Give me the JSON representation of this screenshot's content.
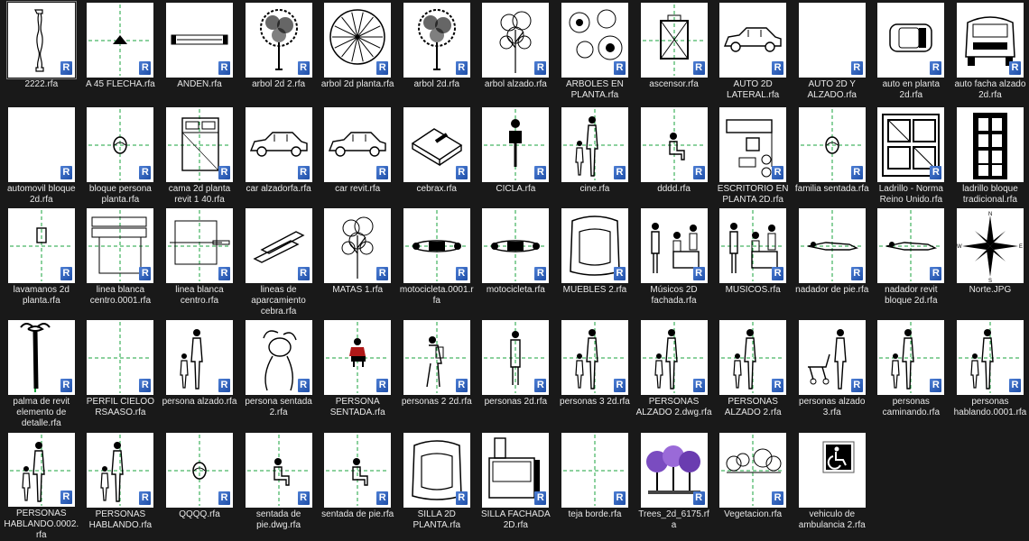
{
  "explorer": {
    "colors": {
      "background": "#191919",
      "thumb": "#ffffff",
      "text": "#e8e8e8",
      "badge": "#2c62c0",
      "crosshair": "#1aa33c"
    },
    "badge_letter": "R",
    "items": [
      {
        "label": "2222.rfa",
        "icon": "baluster-icon",
        "badge": true,
        "cross": false,
        "selected": true
      },
      {
        "label": "A 45 FLECHA.rfa",
        "icon": "arrow-symbol-icon",
        "badge": true,
        "cross": true
      },
      {
        "label": "ANDEN.rfa",
        "icon": "platform-icon",
        "badge": true,
        "cross": false
      },
      {
        "label": "arbol 2d 2.rfa",
        "icon": "tree-icon",
        "badge": true,
        "cross": false
      },
      {
        "label": "arbol 2d planta.rfa",
        "icon": "tree-plan-icon",
        "badge": true,
        "cross": false
      },
      {
        "label": "arbol 2d.rfa",
        "icon": "tree-icon",
        "badge": true,
        "cross": false
      },
      {
        "label": "arbol alzado.rfa",
        "icon": "tree-elevation-icon",
        "badge": true,
        "cross": false
      },
      {
        "label": "ARBOLES EN PLANTA.rfa",
        "icon": "tree-plans-icon",
        "badge": true,
        "cross": false
      },
      {
        "label": "ascensor.rfa",
        "icon": "elevator-icon",
        "badge": true,
        "cross": true
      },
      {
        "label": "AUTO 2D LATERAL.rfa",
        "icon": "car-side-icon",
        "badge": true,
        "cross": false
      },
      {
        "label": "AUTO 2D Y ALZADO.rfa",
        "icon": "blank-icon",
        "badge": true,
        "cross": false
      },
      {
        "label": "auto en planta 2d.rfa",
        "icon": "car-plan-icon",
        "badge": true,
        "cross": false
      },
      {
        "label": "auto facha alzado 2d.rfa",
        "icon": "car-front-icon",
        "badge": true,
        "cross": false
      },
      {
        "label": "automovil bloque 2d.rfa",
        "icon": "blank-icon",
        "badge": true,
        "cross": false
      },
      {
        "label": "bloque persona planta.rfa",
        "icon": "person-plan-icon",
        "badge": true,
        "cross": true
      },
      {
        "label": "cama 2d planta revit 1 40.rfa",
        "icon": "bed-icon",
        "badge": true,
        "cross": true
      },
      {
        "label": "car alzadorfa.rfa",
        "icon": "car-side-icon",
        "badge": true,
        "cross": false
      },
      {
        "label": "car revit.rfa",
        "icon": "car-side-icon",
        "badge": true,
        "cross": false
      },
      {
        "label": "cebrax.rfa",
        "icon": "zebra-block-icon",
        "badge": true,
        "cross": false
      },
      {
        "label": "CICLA.rfa",
        "icon": "bicycle-icon",
        "badge": true,
        "cross": true
      },
      {
        "label": "cine.rfa",
        "icon": "people-icon",
        "badge": true,
        "cross": true
      },
      {
        "label": "dddd.rfa",
        "icon": "seated-person-icon",
        "badge": true,
        "cross": true
      },
      {
        "label": "ESCRITORIO EN PLANTA 2D.rfa",
        "icon": "desk-plan-icon",
        "badge": true,
        "cross": false
      },
      {
        "label": "familia sentada.rfa",
        "icon": "person-plan-icon",
        "badge": true,
        "cross": true
      },
      {
        "label": "Ladrillo - Norma Reino Unido.rfa",
        "icon": "brick-icon",
        "badge": true,
        "cross": false
      },
      {
        "label": "ladrillo bloque tradicional.rfa",
        "icon": "brick-block-icon",
        "badge": false,
        "cross": false
      },
      {
        "label": "lavamanos 2d planta.rfa",
        "icon": "sink-icon",
        "badge": true,
        "cross": true
      },
      {
        "label": "linea blanca centro.0001.rfa",
        "icon": "appliance-icon",
        "badge": true,
        "cross": true
      },
      {
        "label": "linea blanca centro.rfa",
        "icon": "appliance2-icon",
        "badge": true,
        "cross": true
      },
      {
        "label": "lineas de aparcamiento cebra.rfa",
        "icon": "parking-lines-icon",
        "badge": true,
        "cross": false
      },
      {
        "label": "MATAS 1.rfa",
        "icon": "tree-elevation-icon",
        "badge": true,
        "cross": false
      },
      {
        "label": "motocicleta.0001.rfa",
        "icon": "motorcycle-icon",
        "badge": true,
        "cross": true
      },
      {
        "label": "motocicleta.rfa",
        "icon": "motorcycle-icon",
        "badge": true,
        "cross": true
      },
      {
        "label": "MUEBLES 2.rfa",
        "icon": "armchair-icon",
        "badge": true,
        "cross": false
      },
      {
        "label": "Músicos 2D fachada.rfa",
        "icon": "musicians-icon",
        "badge": true,
        "cross": false
      },
      {
        "label": "MUSICOS.rfa",
        "icon": "musicians-icon",
        "badge": true,
        "cross": true
      },
      {
        "label": "nadador de pie.rfa",
        "icon": "swimmer-icon",
        "badge": true,
        "cross": true
      },
      {
        "label": "nadador revit bloque 2d.rfa",
        "icon": "swimmer-icon",
        "badge": true,
        "cross": true
      },
      {
        "label": "Norte.JPG",
        "icon": "compass-icon",
        "badge": false,
        "cross": false
      },
      {
        "label": "palma de revit elemento de detalle.rfa",
        "icon": "palm-icon",
        "badge": true,
        "cross": false
      },
      {
        "label": "PERFIL CIELOO RSAASO.rfa",
        "icon": "blank-icon",
        "badge": true,
        "cross": true
      },
      {
        "label": "persona alzado.rfa",
        "icon": "people-icon",
        "badge": true,
        "cross": false
      },
      {
        "label": "persona sentada 2.rfa",
        "icon": "person-top-icon",
        "badge": true,
        "cross": false
      },
      {
        "label": "PERSONA SENTADA.rfa",
        "icon": "person-red-icon",
        "badge": true,
        "cross": true
      },
      {
        "label": "personas 2 2d.rfa",
        "icon": "walker-icon",
        "badge": true,
        "cross": true
      },
      {
        "label": "personas 2d.rfa",
        "icon": "standing-person-icon",
        "badge": true,
        "cross": true
      },
      {
        "label": "personas 3 2d.rfa",
        "icon": "people-icon",
        "badge": true,
        "cross": true
      },
      {
        "label": "PERSONAS ALZADO 2.dwg.rfa",
        "icon": "people-icon",
        "badge": true,
        "cross": true
      },
      {
        "label": "PERSONAS ALZADO 2.rfa",
        "icon": "people-icon",
        "badge": true,
        "cross": true
      },
      {
        "label": "personas alzado 3.rfa",
        "icon": "stroller-icon",
        "badge": true,
        "cross": false
      },
      {
        "label": "personas caminando.rfa",
        "icon": "people-icon",
        "badge": true,
        "cross": true
      },
      {
        "label": "personas hablando.0001.rfa",
        "icon": "people-icon",
        "badge": true,
        "cross": true
      },
      {
        "label": "PERSONAS HABLANDO.0002.rfa",
        "icon": "people-icon",
        "badge": true,
        "cross": true
      },
      {
        "label": "PERSONAS HABLANDO.rfa",
        "icon": "people-icon",
        "badge": true,
        "cross": true
      },
      {
        "label": "QQQQ.rfa",
        "icon": "person-plan-icon",
        "badge": true,
        "cross": true
      },
      {
        "label": "sentada de pie.dwg.rfa",
        "icon": "seated-person-icon",
        "badge": true,
        "cross": true
      },
      {
        "label": "sentada de pie.rfa",
        "icon": "seated-person-icon",
        "badge": true,
        "cross": true
      },
      {
        "label": "SILLA 2D PLANTA.rfa",
        "icon": "armchair-icon",
        "badge": true,
        "cross": false
      },
      {
        "label": "SILLA FACHADA 2D.rfa",
        "icon": "chair-front-icon",
        "badge": true,
        "cross": false
      },
      {
        "label": "teja borde.rfa",
        "icon": "blank-icon",
        "badge": true,
        "cross": true
      },
      {
        "label": "Trees_2d_6175.rfa",
        "icon": "purple-trees-icon",
        "badge": true,
        "cross": false
      },
      {
        "label": "Vegetacion.rfa",
        "icon": "vegetation-icon",
        "badge": true,
        "cross": true
      },
      {
        "label": "vehiculo de ambulancia 2.rfa",
        "icon": "wheelchair-icon",
        "badge": false,
        "cross": false
      }
    ]
  }
}
